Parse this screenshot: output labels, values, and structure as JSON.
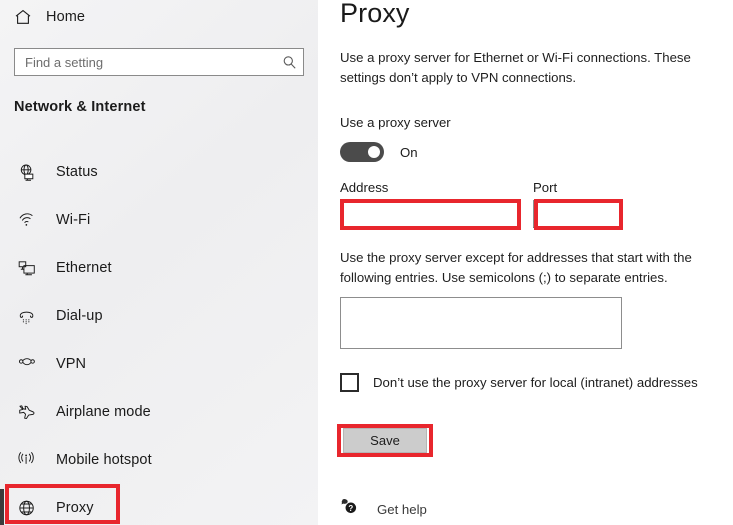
{
  "sidebar": {
    "home": {
      "label": "Home",
      "icon": "home-icon"
    },
    "search": {
      "placeholder": "Find a setting",
      "value": "",
      "icon": "search-icon"
    },
    "section_title": "Network & Internet",
    "items": [
      {
        "label": "Status",
        "icon": "status-globe-monitor-icon",
        "selected": false
      },
      {
        "label": "Wi-Fi",
        "icon": "wifi-icon",
        "selected": false
      },
      {
        "label": "Ethernet",
        "icon": "ethernet-monitor-icon",
        "selected": false
      },
      {
        "label": "Dial-up",
        "icon": "dialup-phone-icon",
        "selected": false
      },
      {
        "label": "VPN",
        "icon": "vpn-icon",
        "selected": false
      },
      {
        "label": "Airplane mode",
        "icon": "airplane-icon",
        "selected": false
      },
      {
        "label": "Mobile hotspot",
        "icon": "hotspot-broadcast-icon",
        "selected": false
      },
      {
        "label": "Proxy",
        "icon": "globe-icon",
        "selected": true
      }
    ]
  },
  "main": {
    "title": "Proxy",
    "description": "Use a proxy server for Ethernet or Wi-Fi connections. These settings don’t apply to VPN connections.",
    "use_proxy_label": "Use a proxy server",
    "toggle_state": "On",
    "address_label": "Address",
    "address_value": "",
    "port_label": "Port",
    "port_value": "",
    "exception_description": "Use the proxy server except for addresses that start with the following entries. Use semicolons (;) to separate entries.",
    "exception_value": "",
    "checkbox_label": "Don’t use the proxy server for local (intranet) addresses",
    "checkbox_checked": false,
    "save_label": "Save",
    "get_help_label": "Get help"
  },
  "annotations": {
    "highlight_color": "#e8262d",
    "boxes": [
      "proxy-sidebar-item",
      "address-field",
      "port-field",
      "save-button"
    ]
  }
}
